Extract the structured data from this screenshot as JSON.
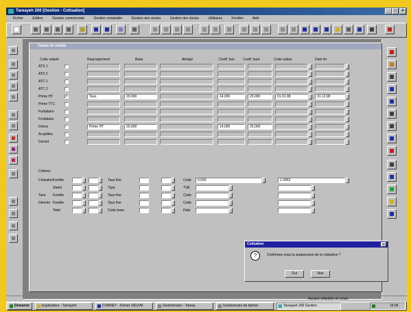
{
  "window": {
    "title": "Tareayeh 200 [Gestion - Cotisation]"
  },
  "menu": [
    "Fichier",
    "Edition",
    "Gestion commerciale",
    "Gestion comptable",
    "Gestion des ventes",
    "Gestion des stocks",
    "Utilitaires",
    "Fenêtre",
    "Aide"
  ],
  "child": {
    "title": "Caisse de retraite"
  },
  "headers": [
    "Regroupement",
    "Base",
    "Abrégé",
    "Coeff. bas",
    "Coeff. haut",
    "Code valeur",
    "Date fin"
  ],
  "left_title": "Code salarié",
  "rows": [
    {
      "label": "ATS 1",
      "checked": false,
      "reg": "",
      "base": "",
      "abr": "",
      "cb": "",
      "ch": "",
      "cv": "",
      "df": ""
    },
    {
      "label": "ATS 2",
      "checked": false,
      "reg": "",
      "base": "",
      "abr": "",
      "cb": "",
      "ch": "",
      "cv": "",
      "df": ""
    },
    {
      "label": "ATC 1",
      "checked": false,
      "reg": "",
      "base": "",
      "abr": "",
      "cb": "",
      "ch": "",
      "cv": "",
      "df": ""
    },
    {
      "label": "ATC 2",
      "checked": false,
      "reg": "",
      "base": "",
      "abr": "",
      "cb": "",
      "ch": "",
      "cv": "",
      "df": ""
    },
    {
      "label": "Prime HT",
      "checked": true,
      "reg": "Taux",
      "base": "20,000",
      "abr": "",
      "cb": "14,000",
      "ch": "20,000",
      "cv": "01.01.98",
      "df": "31.12.98"
    },
    {
      "label": "Prime TTC",
      "checked": false,
      "reg": "",
      "base": "",
      "abr": "",
      "cb": "",
      "ch": "",
      "cv": "",
      "df": ""
    },
    {
      "label": "Forfaitaire",
      "checked": false,
      "reg": "",
      "base": "",
      "abr": "",
      "cb": "",
      "ch": "",
      "cv": "",
      "df": ""
    },
    {
      "label": "Forfaitaire",
      "checked": false,
      "reg": "",
      "base": "",
      "abr": "",
      "cb": "",
      "ch": "",
      "cv": "",
      "df": ""
    },
    {
      "label": "Divers",
      "checked": false,
      "reg": "Prime HT",
      "base": "20,000",
      "abr": "",
      "cb": "14,000",
      "ch": "20,000",
      "cv": "",
      "df": ""
    },
    {
      "label": "Acquittée",
      "checked": false,
      "reg": "",
      "base": "",
      "abr": "",
      "cb": "",
      "ch": "",
      "cv": "",
      "df": ""
    },
    {
      "label": "Durant",
      "checked": false,
      "reg": "",
      "base": "",
      "abr": "",
      "cb": "",
      "ch": "",
      "cv": "",
      "df": ""
    }
  ],
  "lower": {
    "section_label": "Critères",
    "rows": [
      {
        "a": "Cotisation",
        "b": "Famille",
        "c": "Taux fixe",
        "d": "Code",
        "e": "1"
      },
      {
        "a": "",
        "b": "Statut",
        "c": "Type",
        "d": "TVA",
        "e": ""
      },
      {
        "a": "Taxe",
        "b": "Famille",
        "c": "Taux fixe",
        "d": "Code",
        "e": ""
      },
      {
        "a": "Dérivée",
        "b": "Famille",
        "c": "Taux fixe",
        "d": "Code",
        "e": ""
      },
      {
        "a": "",
        "b": "Total",
        "c": "Code base",
        "d": "Date",
        "e": ""
      }
    ],
    "code_field": "0,000",
    "num_field": "1 0852"
  },
  "dialog": {
    "title": "Cotisation",
    "message": "Confirmez-vous la suppression de la cotisation ?",
    "yes": "Oui",
    "no": "Non"
  },
  "taskbar": {
    "start": "Démarrer",
    "tasks": [
      "Explorateur - Tareayeh",
      "CORNET - Fichier OEUVR",
      "Gestionnaire - Tareay",
      "Gestionnaire de tâches",
      "Tareayeh 200 Gestion"
    ],
    "clock": "16:05"
  },
  "statusbar": {
    "text": "Aucune sélection en cours"
  }
}
